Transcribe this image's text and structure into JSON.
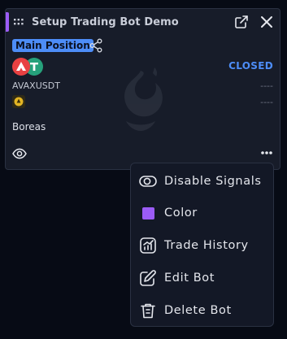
{
  "card": {
    "title": "Setup Trading Bot Demo",
    "position_badge": "Main Position",
    "status": "CLOSED",
    "symbol": "AVAXUSDT",
    "value_1": "----",
    "value_2": "----",
    "bot_name": "Boreas",
    "accent_color": "#9b5cf6",
    "status_color": "#4d8df7",
    "icons": {
      "drag": "drag-handle-icon",
      "open": "open-external-icon",
      "close": "close-icon",
      "share": "share-icon",
      "visibility": "eye-icon",
      "more": "more-horizontal-icon"
    }
  },
  "menu": {
    "items": [
      {
        "label": "Disable Signals",
        "icon": "toggle-icon"
      },
      {
        "label": "Color",
        "icon": "color-swatch",
        "swatch_color": "#9b5cf6"
      },
      {
        "label": "Trade History",
        "icon": "chart-icon"
      },
      {
        "label": "Edit Bot",
        "icon": "edit-icon"
      },
      {
        "label": "Delete Bot",
        "icon": "trash-icon"
      }
    ]
  }
}
